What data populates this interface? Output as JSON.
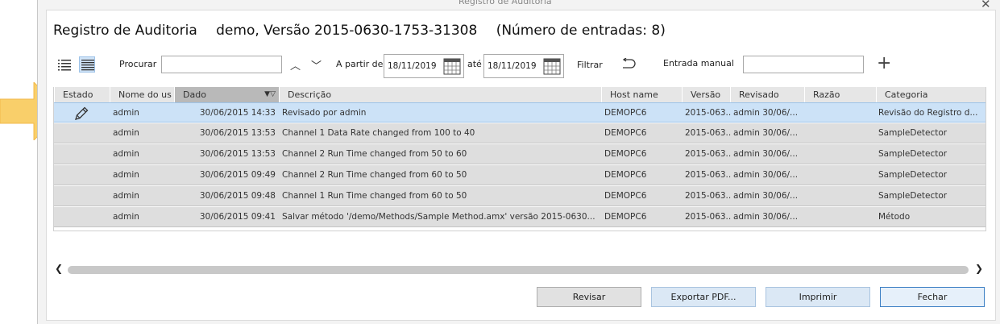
{
  "window": {
    "title": "Registro de Auditoria"
  },
  "heading": {
    "name": "Registro de Auditoria",
    "version": "demo, Versão 2015-0630-1753-31308",
    "count": "(Número de entradas: 8)"
  },
  "toolbar": {
    "search_label": "Procurar",
    "search_value": "",
    "from_label": "A partir de",
    "from_date": "18/11/2019",
    "to_label": "até",
    "to_date": "18/11/2019",
    "filter_label": "Filtrar",
    "manual_label": "Entrada manual",
    "manual_value": ""
  },
  "columns": [
    "Estado",
    "Nome do us",
    "Dado",
    "Descrição",
    "Host name",
    "Versão",
    "Revisado",
    "Razão",
    "Categoria"
  ],
  "rows": [
    {
      "status": "pencil-icon",
      "user": "admin",
      "date": "30/06/2015 14:33",
      "desc": "Revisado por admin",
      "host": "DEMOPC6",
      "version": "2015-063...",
      "reviewed": "admin 30/06/...",
      "reason": "",
      "category": "Revisão do Registro d...",
      "selected": true
    },
    {
      "status": "",
      "user": "admin",
      "date": "30/06/2015 13:53",
      "desc": "Channel 1 Data Rate changed from 100 to 40",
      "host": "DEMOPC6",
      "version": "2015-063...",
      "reviewed": "admin 30/06/...",
      "reason": "",
      "category": "SampleDetector",
      "selected": false
    },
    {
      "status": "",
      "user": "admin",
      "date": "30/06/2015 13:53",
      "desc": "Channel 2 Run Time changed from 50 to 60",
      "host": "DEMOPC6",
      "version": "2015-063...",
      "reviewed": "admin 30/06/...",
      "reason": "",
      "category": "SampleDetector",
      "selected": false
    },
    {
      "status": "",
      "user": "admin",
      "date": "30/06/2015 09:49",
      "desc": "Channel 2 Run Time changed from 60 to 50",
      "host": "DEMOPC6",
      "version": "2015-063...",
      "reviewed": "admin 30/06/...",
      "reason": "",
      "category": "SampleDetector",
      "selected": false
    },
    {
      "status": "",
      "user": "admin",
      "date": "30/06/2015 09:48",
      "desc": "Channel 1 Run Time changed from 60 to 50",
      "host": "DEMOPC6",
      "version": "2015-063...",
      "reviewed": "admin 30/06/...",
      "reason": "",
      "category": "SampleDetector",
      "selected": false
    },
    {
      "status": "",
      "user": "admin",
      "date": "30/06/2015 09:41",
      "desc": "Salvar método '/demo/Methods/Sample Method.amx' versão 2015-0630...",
      "host": "DEMOPC6",
      "version": "2015-063...",
      "reviewed": "admin 30/06/...",
      "reason": "",
      "category": "Método",
      "selected": false
    }
  ],
  "buttons": {
    "review": "Revisar",
    "export": "Exportar PDF...",
    "print": "Imprimir",
    "close": "Fechar"
  },
  "colors": {
    "selection": "#cce2f7",
    "row": "#dedede",
    "arrow": "#f9cf6a",
    "default_border": "#3c7fc4"
  }
}
